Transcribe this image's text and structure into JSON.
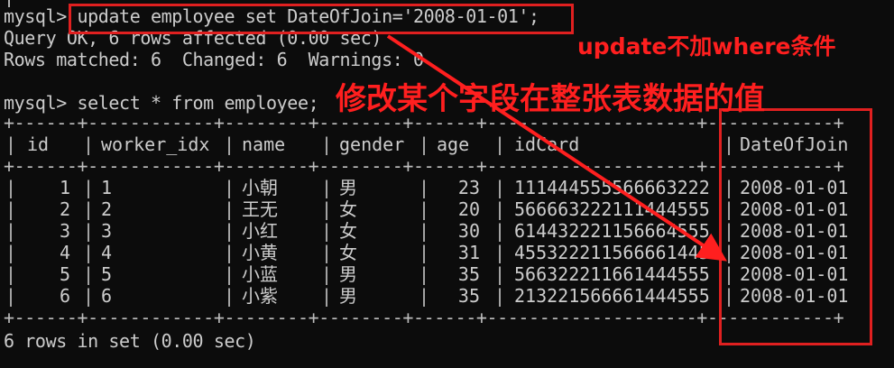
{
  "terminal": {
    "top_partial": "|",
    "update_cmd": "mysql> update employee set DateOfJoin='2008-01-01';",
    "query_ok": "Query OK, 6 rows affected (0.00 sec)",
    "rows_matched": "Rows matched: 6  Changed: 6  Warnings: 0",
    "select_cmd": "mysql> select * from employee;",
    "border": "+------+------------+--------+--------+------+--------------------+------------+",
    "headers": [
      "id",
      "worker_idx",
      "name",
      "gender",
      "age",
      "idCard",
      "DateOfJoin"
    ],
    "rows": [
      [
        "1",
        "1",
        "小朝",
        "男",
        "23",
        "111444555566663222",
        "2008-01-01"
      ],
      [
        "2",
        "2",
        "王无",
        "女",
        "20",
        "566663222111444555",
        "2008-01-01"
      ],
      [
        "3",
        "3",
        "小红",
        "女",
        "30",
        "614432221156664555",
        "2008-01-01"
      ],
      [
        "4",
        "4",
        "小黄",
        "女",
        "31",
        "455322211566661445",
        "2008-01-01"
      ],
      [
        "5",
        "5",
        "小蓝",
        "男",
        "35",
        "566322211661444555",
        "2008-01-01"
      ],
      [
        "6",
        "6",
        "小紫",
        "男",
        "35",
        "213221566661444555",
        "2008-01-01"
      ]
    ],
    "footer": "6 rows in set (0.00 sec)"
  },
  "annotations": {
    "note_small": "update不加where条件",
    "note_large": "修改某个字段在整张表数据的值",
    "color": "#ff1f1f"
  }
}
